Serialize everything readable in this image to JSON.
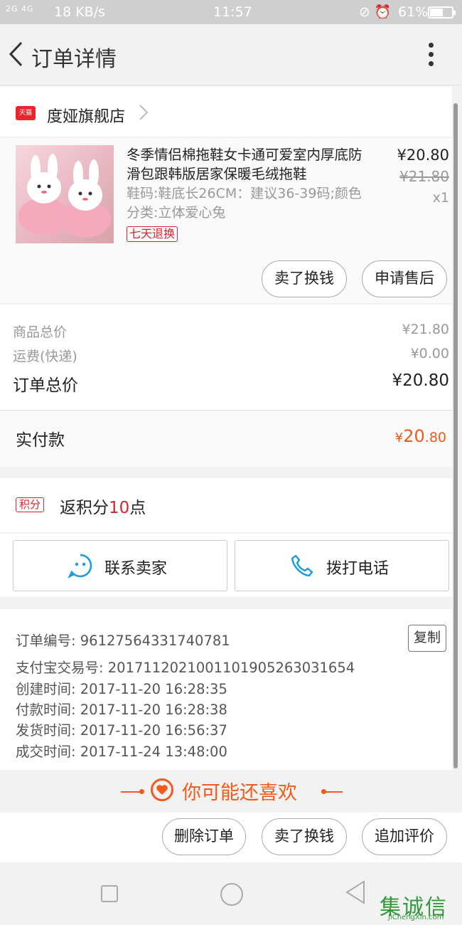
{
  "status_bar": {
    "signal": "2G 4G",
    "speed": "18 KB/s",
    "time": "11:57",
    "battery_text": "61%",
    "battery_level": 0.61
  },
  "header": {
    "title": "订单详情"
  },
  "store": {
    "badge": "天猫",
    "name": "度娅旗舰店"
  },
  "product": {
    "title": "冬季情侣棉拖鞋女卡通可爱室内厚底防滑包跟韩版居家保暖毛绒拖鞋",
    "sku": "鞋码:鞋底长26CM：建议36-39码;颜色分类:立体爱心兔",
    "tag": "七天退换",
    "price": "¥20.80",
    "original_price": "¥21.80",
    "quantity": "x1",
    "sell_label": "卖了换钱",
    "after_sale_label": "申请售后"
  },
  "totals": {
    "goods_label": "商品总价",
    "goods_value": "¥21.80",
    "shipping_label": "运费(快递)",
    "shipping_value": "¥0.00",
    "order_label": "订单总价",
    "order_value": "¥20.80",
    "paid_label": "实付款",
    "paid_yen": "¥",
    "paid_int": "20",
    "paid_dec": ".80"
  },
  "points": {
    "badge": "积分",
    "text_prefix": "返积分",
    "value": "10",
    "text_suffix": "点"
  },
  "contact": {
    "seller_label": "联系卖家",
    "phone_label": "拨打电话"
  },
  "order_info": {
    "order_no": "订单编号: 96127564331740781",
    "copy_label": "复制",
    "alipay_no": "支付宝交易号: 2017112021001101905263031654",
    "created": "创建时间: 2017-11-20 16:28:35",
    "paid": "付款时间: 2017-11-20 16:28:38",
    "shipped": "发货时间: 2017-11-20 16:56:37",
    "completed": "成交时间: 2017-11-24 13:48:00"
  },
  "recommend": {
    "title": "你可能还喜欢"
  },
  "actions": {
    "delete_label": "删除订单",
    "sell_label": "卖了换钱",
    "review_label": "追加评价"
  },
  "watermark": {
    "big": "集诚信",
    "small": "JiChengXin.com"
  },
  "colors": {
    "accent": "#f05a1a",
    "tmall_red": "#d9232e",
    "contact_icon": "#1a9be0"
  }
}
